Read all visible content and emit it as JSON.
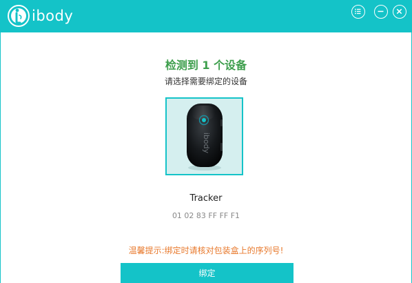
{
  "app": {
    "logo_text": "ibody"
  },
  "colors": {
    "accent": "#14c3c8",
    "title_green": "#3d9e4c",
    "tip_orange": "#e8792c"
  },
  "window_controls": [
    {
      "name": "menu",
      "icon": "menu-list-icon"
    },
    {
      "name": "minimize",
      "icon": "minimize-icon"
    },
    {
      "name": "close",
      "icon": "close-icon"
    }
  ],
  "main": {
    "title": "检测到 1 个设备",
    "subtitle": "请选择需要绑定的设备",
    "device": {
      "name": "Tracker",
      "serial": "01 02 83 FF FF F1",
      "image_label": "ibody"
    },
    "tip": "温馨提示:绑定时请核对包装盒上的序列号!",
    "bind_button": "绑定"
  }
}
